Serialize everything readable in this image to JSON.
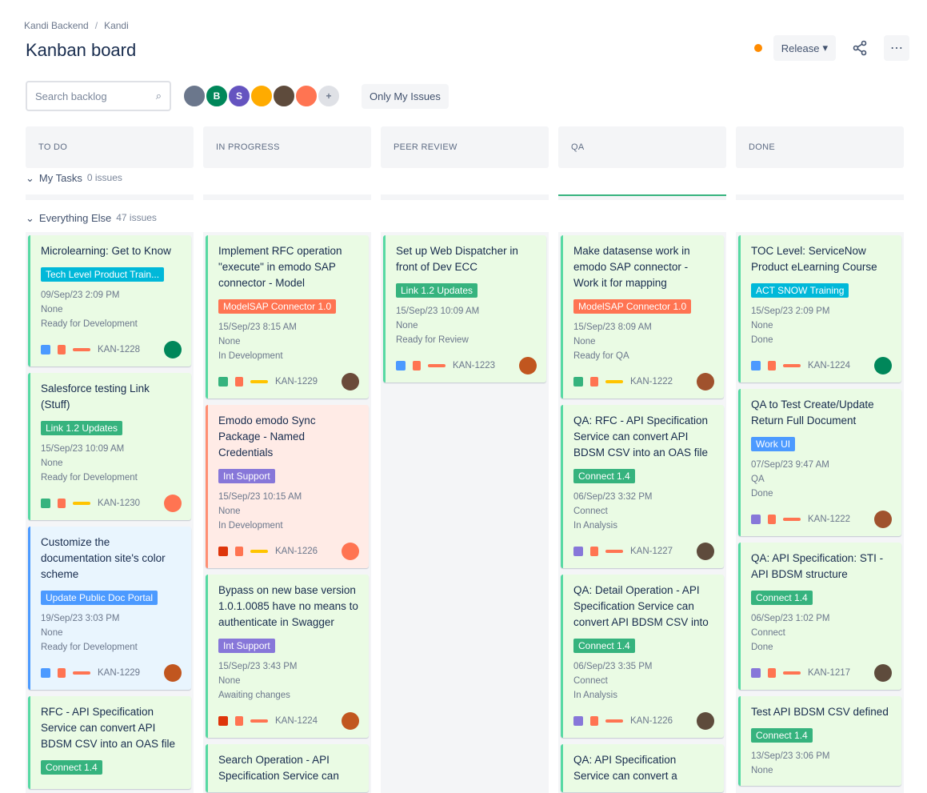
{
  "breadcrumb": {
    "project": "Kandi Backend",
    "board": "Kandi"
  },
  "page_title": "Kanban board",
  "header": {
    "release_label": "Release",
    "release_caret": "▾",
    "share_icon": "⇆",
    "more_icon": "⋯"
  },
  "toolbar": {
    "search_placeholder": "Search backlog",
    "search_icon": "⌕",
    "only_my_issues": "Only My Issues"
  },
  "avatars": [
    {
      "initial": "",
      "color": "#6b778c"
    },
    {
      "initial": "B",
      "color": "#00875a"
    },
    {
      "initial": "S",
      "color": "#6554c0"
    },
    {
      "initial": "",
      "color": "#ffab00"
    },
    {
      "initial": "",
      "color": "#5e4b3c"
    },
    {
      "initial": "",
      "color": "#ff7452"
    },
    {
      "initial": "+",
      "color": "#dfe1e6"
    }
  ],
  "columns": [
    "TO DO",
    "IN PROGRESS",
    "PEER REVIEW",
    "QA",
    "DONE"
  ],
  "swimlanes": {
    "my_tasks": {
      "label": "My Tasks",
      "count": "0 issues"
    },
    "everything_else": {
      "label": "Everything Else",
      "count": "47 issues"
    }
  },
  "cards": [
    [
      {
        "title": "Microlearning: Get to Know",
        "tag": "Tech Level Product Train...",
        "tag_color": "#00b8d9",
        "date": "09/Sep/23 2:09 PM",
        "line2": "None",
        "line3": "Ready for Development",
        "key": "KAN-1228",
        "style": "green",
        "sq": "#4c9aff",
        "ln": "#ff7452",
        "av": "#00875a"
      },
      {
        "title": "Salesforce testing Link (Stuff)",
        "tag": "Link 1.2 Updates",
        "tag_color": "#36b37e",
        "date": "15/Sep/23 10:09 AM",
        "line2": "None",
        "line3": "Ready for Development",
        "key": "KAN-1230",
        "style": "green",
        "sq": "#36b37e",
        "ln": "#ffc400",
        "av": "#ff7452"
      },
      {
        "title": "Customize the documentation site's color scheme",
        "tag": "Update Public Doc Portal",
        "tag_color": "#4c9aff",
        "date": "19/Sep/23 3:03 PM",
        "line2": "None",
        "line3": "Ready for Development",
        "key": "KAN-1229",
        "style": "blue",
        "sq": "#4c9aff",
        "ln": "#ff7452",
        "av": "#c1561f"
      },
      {
        "title": "RFC - API Specification Service can convert API BDSM CSV into an OAS file",
        "tag": "Connect 1.4",
        "tag_color": "#36b37e",
        "date": "",
        "line2": "",
        "line3": "",
        "key": "",
        "style": "green",
        "sq": "#36b37e",
        "ln": "#ffc400",
        "av": "#ff7452"
      }
    ],
    [
      {
        "title": "Implement RFC operation \"execute\" in emodo SAP connector - Model",
        "tag": "ModelSAP Connector 1.0",
        "tag_color": "#ff7452",
        "date": "15/Sep/23 8:15 AM",
        "line2": "None",
        "line3": "In Development",
        "key": "KAN-1229",
        "style": "green",
        "sq": "#36b37e",
        "ln": "#ffc400",
        "av": "#6b4a3a"
      },
      {
        "title": "Emodo emodo Sync Package - Named Credentials",
        "tag": "Int Support",
        "tag_color": "#8777d9",
        "date": "15/Sep/23 10:15 AM",
        "line2": "None",
        "line3": "In Development",
        "key": "KAN-1226",
        "style": "red",
        "sq": "#de350b",
        "ln": "#ffc400",
        "av": "#ff7452"
      },
      {
        "title": "Bypass on new base version 1.0.1.0085 have no means to authenticate in Swagger",
        "tag": "Int Support",
        "tag_color": "#8777d9",
        "date": "15/Sep/23 3:43 PM",
        "line2": "None",
        "line3": "Awaiting changes",
        "key": "KAN-1224",
        "style": "green",
        "sq": "#de350b",
        "ln": "#ff7452",
        "av": "#c1561f"
      },
      {
        "title": "Search Operation - API Specification Service can",
        "tag": "",
        "tag_color": "",
        "date": "",
        "line2": "",
        "line3": "",
        "key": "",
        "style": "green",
        "sq": "#36b37e",
        "ln": "#ffc400",
        "av": "#6b4a3a"
      }
    ],
    [
      {
        "title": "Set up Web Dispatcher in front of Dev ECC",
        "tag": "Link 1.2 Updates",
        "tag_color": "#36b37e",
        "date": "15/Sep/23 10:09 AM",
        "line2": "None",
        "line3": "Ready for Review",
        "key": "KAN-1223",
        "style": "green",
        "sq": "#4c9aff",
        "ln": "#ff7452",
        "av": "#c1561f"
      }
    ],
    [
      {
        "title": "Make datasense work in emodo SAP connector - Work it for mapping",
        "tag": "ModelSAP Connector 1.0",
        "tag_color": "#ff7452",
        "date": "15/Sep/23 8:09 AM",
        "line2": "None",
        "line3": "Ready for QA",
        "key": "KAN-1222",
        "style": "green",
        "sq": "#36b37e",
        "ln": "#ffc400",
        "av": "#a0522d"
      },
      {
        "title": "QA: RFC - API Specification Service can convert API BDSM CSV into an OAS file",
        "tag": "Connect 1.4",
        "tag_color": "#36b37e",
        "date": "06/Sep/23 3:32 PM",
        "line2": "Connect",
        "line3": "In Analysis",
        "key": "KAN-1227",
        "style": "green",
        "sq": "#8777d9",
        "ln": "#ff7452",
        "av": "#5e4b3c"
      },
      {
        "title": "QA: Detail Operation - API Specification Service can convert API BDSM CSV into",
        "tag": "Connect 1.4",
        "tag_color": "#36b37e",
        "date": "06/Sep/23 3:35 PM",
        "line2": "Connect",
        "line3": "In Analysis",
        "key": "KAN-1226",
        "style": "green",
        "sq": "#8777d9",
        "ln": "#ff7452",
        "av": "#5e4b3c"
      },
      {
        "title": "QA: API Specification Service can convert a",
        "tag": "",
        "tag_color": "",
        "date": "",
        "line2": "",
        "line3": "",
        "key": "",
        "style": "green",
        "sq": "#8777d9",
        "ln": "#ff7452",
        "av": "#5e4b3c"
      }
    ],
    [
      {
        "title": "TOC Level: ServiceNow Product eLearning Course",
        "tag": "ACT SNOW Training",
        "tag_color": "#00b8d9",
        "date": "15/Sep/23 2:09 PM",
        "line2": "None",
        "line3": "Done",
        "key": "KAN-1224",
        "style": "green",
        "sq": "#4c9aff",
        "ln": "#ff7452",
        "av": "#00875a"
      },
      {
        "title": "QA to Test Create/Update Return Full Document",
        "tag": "Work UI",
        "tag_color": "#4c9aff",
        "date": "07/Sep/23 9:47 AM",
        "line2": "QA",
        "line3": "Done",
        "key": "KAN-1222",
        "style": "green",
        "sq": "#8777d9",
        "ln": "#ff7452",
        "av": "#a0522d"
      },
      {
        "title": "QA: API Specification: STI - API BDSM structure",
        "tag": "Connect 1.4",
        "tag_color": "#36b37e",
        "date": "06/Sep/23 1:02 PM",
        "line2": "Connect",
        "line3": "Done",
        "key": "KAN-1217",
        "style": "green",
        "sq": "#8777d9",
        "ln": "#ff7452",
        "av": "#5e4b3c"
      },
      {
        "title": "Test API BDSM CSV defined",
        "tag": "Connect 1.4",
        "tag_color": "#36b37e",
        "date": "13/Sep/23 3:06 PM",
        "line2": "None",
        "line3": "",
        "key": "",
        "style": "green",
        "sq": "#36b37e",
        "ln": "#ffc400",
        "av": "#a0522d"
      }
    ]
  ]
}
